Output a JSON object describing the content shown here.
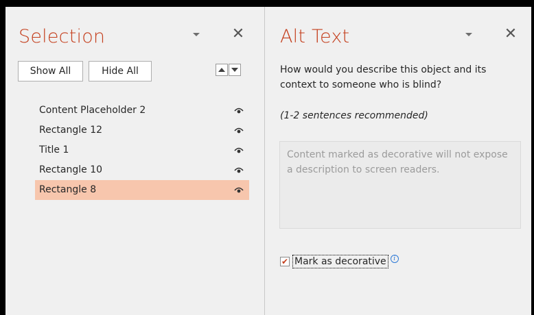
{
  "selection_pane": {
    "title": "Selection",
    "show_all": "Show All",
    "hide_all": "Hide All",
    "items": [
      {
        "label": "Content Placeholder 2",
        "selected": false
      },
      {
        "label": "Rectangle 12",
        "selected": false
      },
      {
        "label": "Title 1",
        "selected": false
      },
      {
        "label": "Rectangle 10",
        "selected": false
      },
      {
        "label": "Rectangle 8",
        "selected": true
      }
    ]
  },
  "alt_text_pane": {
    "title": "Alt Text",
    "prompt": "How would you describe this object and its context to someone who is blind?",
    "hint": "(1-2 sentences recommended)",
    "description_placeholder": "Content marked as decorative will not expose a description to screen readers.",
    "mark_decorative_label": "Mark as decorative",
    "mark_decorative_checked": true
  },
  "colors": {
    "accent": "#c43e1c",
    "selected_row": "#f7c6ad",
    "pane_bg": "#f0f0f0"
  }
}
